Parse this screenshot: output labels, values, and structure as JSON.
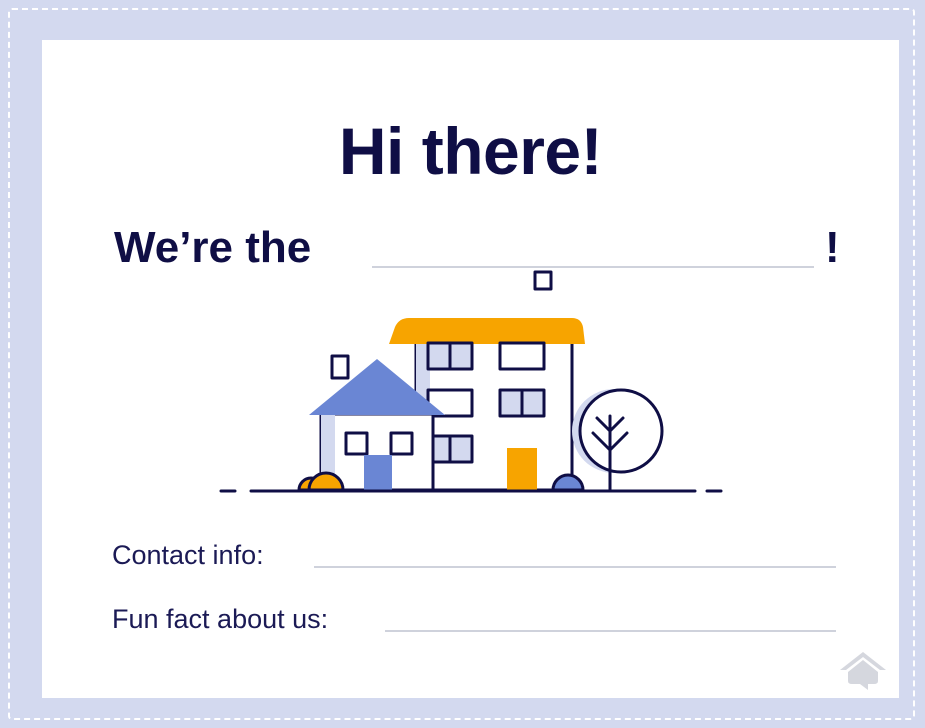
{
  "heading": "Hi there!",
  "intro": "We’re the",
  "intro_end": "!",
  "fields": [
    {
      "label": "Contact info:"
    },
    {
      "label": "Fun fact about us:"
    }
  ],
  "colors": {
    "background": "#d3d9ef",
    "card": "#ffffff",
    "text": "#0f0e45",
    "accent_orange": "#f7a400",
    "accent_blue": "#6a86d4",
    "line": "#cfd2dc"
  },
  "illustration": "house-illustration",
  "logo": "house-logo-icon"
}
